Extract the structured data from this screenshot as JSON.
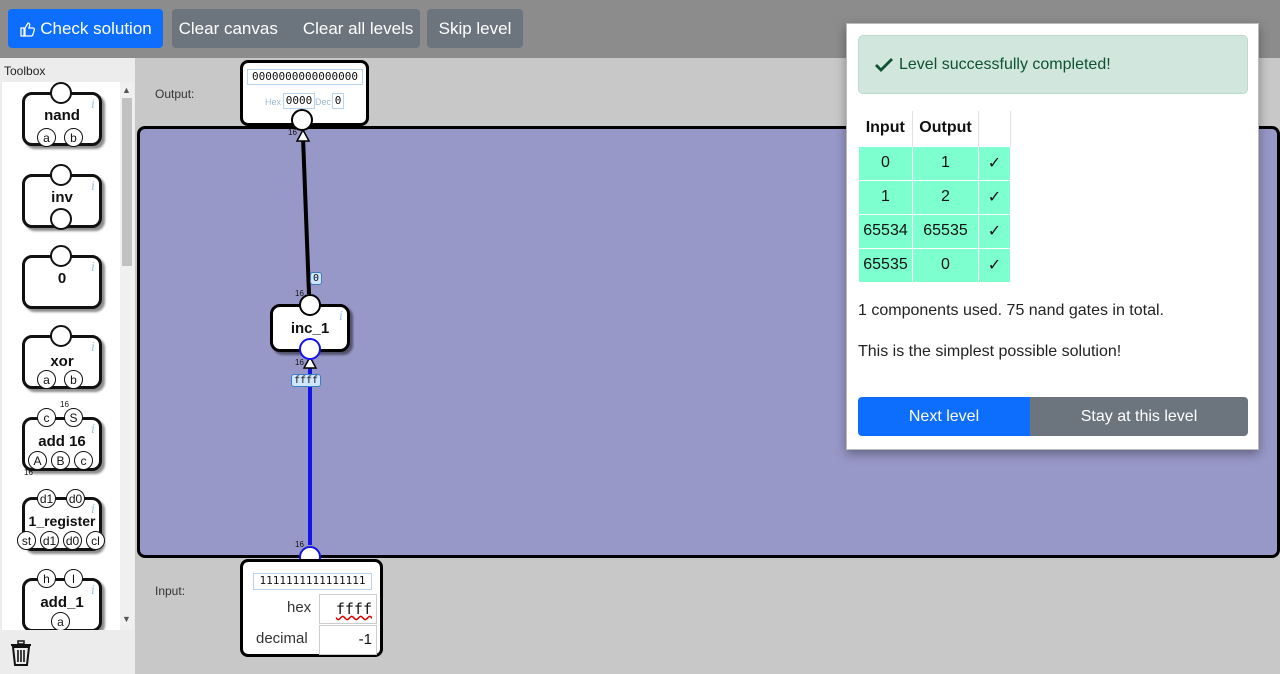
{
  "toolbar": {
    "check_label": "Check solution",
    "clear_canvas_label": "Clear canvas",
    "clear_all_label": "Clear all levels",
    "skip_label": "Skip level"
  },
  "toolbox": {
    "title": "Toolbox",
    "items": [
      {
        "name": "nand",
        "inputs": [
          "a",
          "b"
        ]
      },
      {
        "name": "inv"
      },
      {
        "name": "0"
      },
      {
        "name": "xor",
        "inputs": [
          "a",
          "b"
        ]
      },
      {
        "name": "add 16",
        "top": [
          "c",
          "S"
        ],
        "inputs": [
          "A",
          "B",
          "c"
        ],
        "width_top": "16",
        "width_bottom": "16"
      },
      {
        "name": "1_register",
        "top": [
          "d1",
          "d0"
        ],
        "inputs": [
          "st",
          "d1",
          "d0",
          "cl"
        ]
      },
      {
        "name": "add_1",
        "top": [
          "h",
          "l"
        ],
        "inputs": [
          "a"
        ]
      }
    ]
  },
  "canvas": {
    "output_label": "Output:",
    "input_label": "Input:",
    "output_bits": "0000000000000000",
    "output_hex_label": "Hex",
    "output_hex": "0000",
    "output_dec_label": "Dec",
    "output_dec": "0",
    "input_bits": "1111111111111111",
    "input_hex_label": "hex",
    "input_hex": "ffff",
    "input_dec_label": "decimal",
    "input_dec": "-1",
    "component": "inc_1",
    "wire_value_top": "0",
    "wire_value_bottom": "ffff",
    "width_label": "16"
  },
  "modal": {
    "success": "Level successfully completed!",
    "headers": [
      "Input",
      "Output"
    ],
    "rows": [
      {
        "input": "0",
        "output": "1",
        "check": "✓"
      },
      {
        "input": "1",
        "output": "2",
        "check": "✓"
      },
      {
        "input": "65534",
        "output": "65535",
        "check": "✓"
      },
      {
        "input": "65535",
        "output": "0",
        "check": "✓"
      }
    ],
    "stats": "1 components used. 75 nand gates in total.",
    "simplest": "This is the simplest possible solution!",
    "next_label": "Next level",
    "stay_label": "Stay at this level"
  },
  "colors": {
    "primary": "#0d6efd",
    "secondary": "#6c757d",
    "board": "#9898c8",
    "wire_active": "#1414e6",
    "success_bg": "#d1e7dd",
    "row_ok": "#7dffcf"
  }
}
